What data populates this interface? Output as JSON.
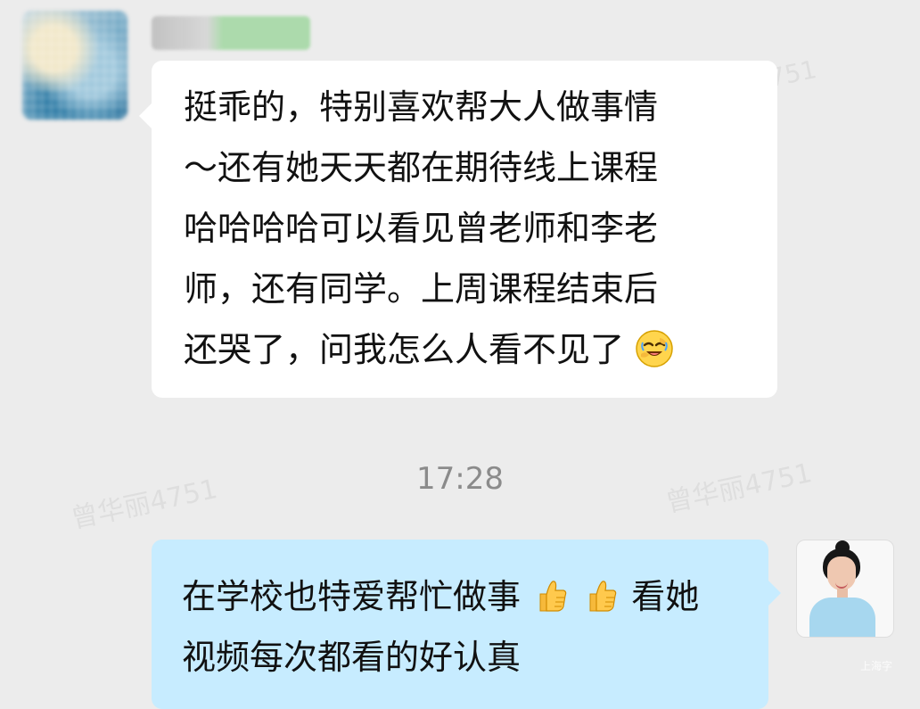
{
  "chat": {
    "messages": [
      {
        "side": "left",
        "lines": [
          "挺乖的，特别喜欢帮大人做事情",
          "～还有她天天都在期待线上课程",
          "哈哈哈哈可以看见曾老师和李老",
          "师，还有同学。上周课程结束后",
          "还哭了，问我怎么人看不见了"
        ],
        "emoji": "face-palm-laughing"
      },
      {
        "side": "right",
        "lines": [
          "在学校也特爱帮忙做事",
          "看她",
          "视频每次都看的好认真"
        ],
        "emoji": "thumbs-up-x2"
      }
    ],
    "timestamp": "17:28",
    "watermarks": [
      "4751",
      "曾华丽4751",
      "曾华丽4751",
      "上海字"
    ]
  },
  "colors": {
    "chat_background": "#ececec",
    "incoming_bubble": "#ffffff",
    "outgoing_bubble": "#c7ecff",
    "timestamp_text": "#8b8b8b"
  },
  "icons": {
    "left_avatar": "blurred-avatar",
    "right_avatar": "profile-photo",
    "left_emoji": "face-palm-laughing",
    "right_emoji_1": "thumbs-up-icon",
    "right_emoji_2": "thumbs-up-icon"
  }
}
